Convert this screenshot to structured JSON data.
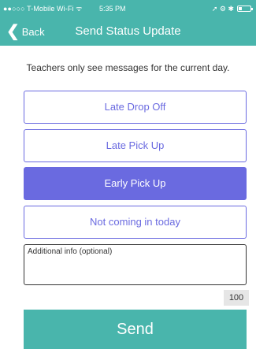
{
  "status_bar": {
    "carrier": "●●○○○ T-Mobile Wi-Fi ᯤ",
    "time": "5:35 PM",
    "icons": "➚ ⚙ ✱"
  },
  "nav": {
    "back_icon": "❮",
    "back_label": "Back",
    "title": "Send Status Update"
  },
  "notice": "Teachers only see messages for the current day.",
  "options": [
    {
      "label": "Late Drop Off",
      "selected": false
    },
    {
      "label": "Late Pick Up",
      "selected": false
    },
    {
      "label": "Early Pick Up",
      "selected": true
    },
    {
      "label": "Not coming in today",
      "selected": false
    }
  ],
  "additional_info": {
    "placeholder": "Additional info (optional)",
    "char_limit": "100"
  },
  "send_label": "Send",
  "colors": {
    "header": "#49b5ac",
    "accent": "#6a6ae0"
  }
}
